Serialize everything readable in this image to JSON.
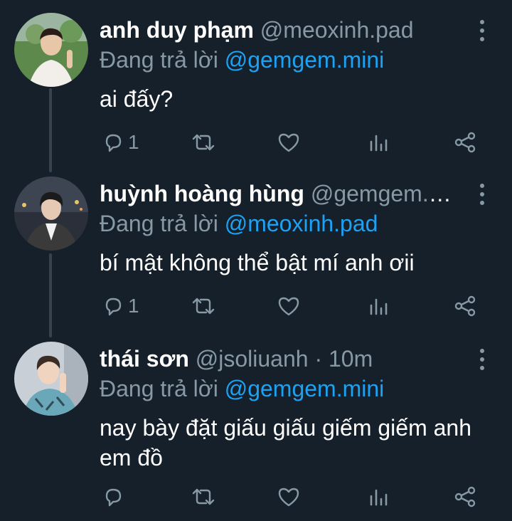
{
  "tweets": [
    {
      "name": "anh duy phạm",
      "handle": "@meoxinh.pad",
      "time": "",
      "reply_prefix": "Đang trả lời",
      "reply_to": "@gemgem.mini",
      "text": "ai đấy?",
      "reply_count": "1",
      "avatar_colors": {
        "bg": "#5d8a4c",
        "shirt": "#f2eeea",
        "skin": "#e8c6a8",
        "hair": "#2a1d18"
      }
    },
    {
      "name": "huỳnh hoàng hùng",
      "handle": "@gemgem.mini",
      "time": "",
      "reply_prefix": "Đang trả lời",
      "reply_to": "@meoxinh.pad",
      "text": "bí mật không thể bật mí anh ơii",
      "reply_count": "1",
      "avatar_colors": {
        "bg": "#2b2f3a",
        "shirt": "#3a3a3a",
        "skin": "#e6c9b4",
        "hair": "#1b1b1b"
      }
    },
    {
      "name": "thái sơn",
      "handle": "@jsoliuanh",
      "time": "· 10m",
      "reply_prefix": "Đang trả lời",
      "reply_to": "@gemgem.mini",
      "text": "nay bày đặt giấu giấu giếm giếm anh em đồ",
      "reply_count": "",
      "avatar_colors": {
        "bg": "#c9cfd6",
        "shirt": "#6aa7b8",
        "skin": "#f0d4c0",
        "hair": "#3b2c24"
      }
    }
  ],
  "icons": [
    "reply-icon",
    "retweet-icon",
    "like-icon",
    "analytics-icon",
    "share-icon",
    "more-icon"
  ],
  "colors": {
    "background": "#15202b",
    "secondary_text": "#8899a6",
    "link": "#1da1f2",
    "thread_line": "#38444d"
  }
}
